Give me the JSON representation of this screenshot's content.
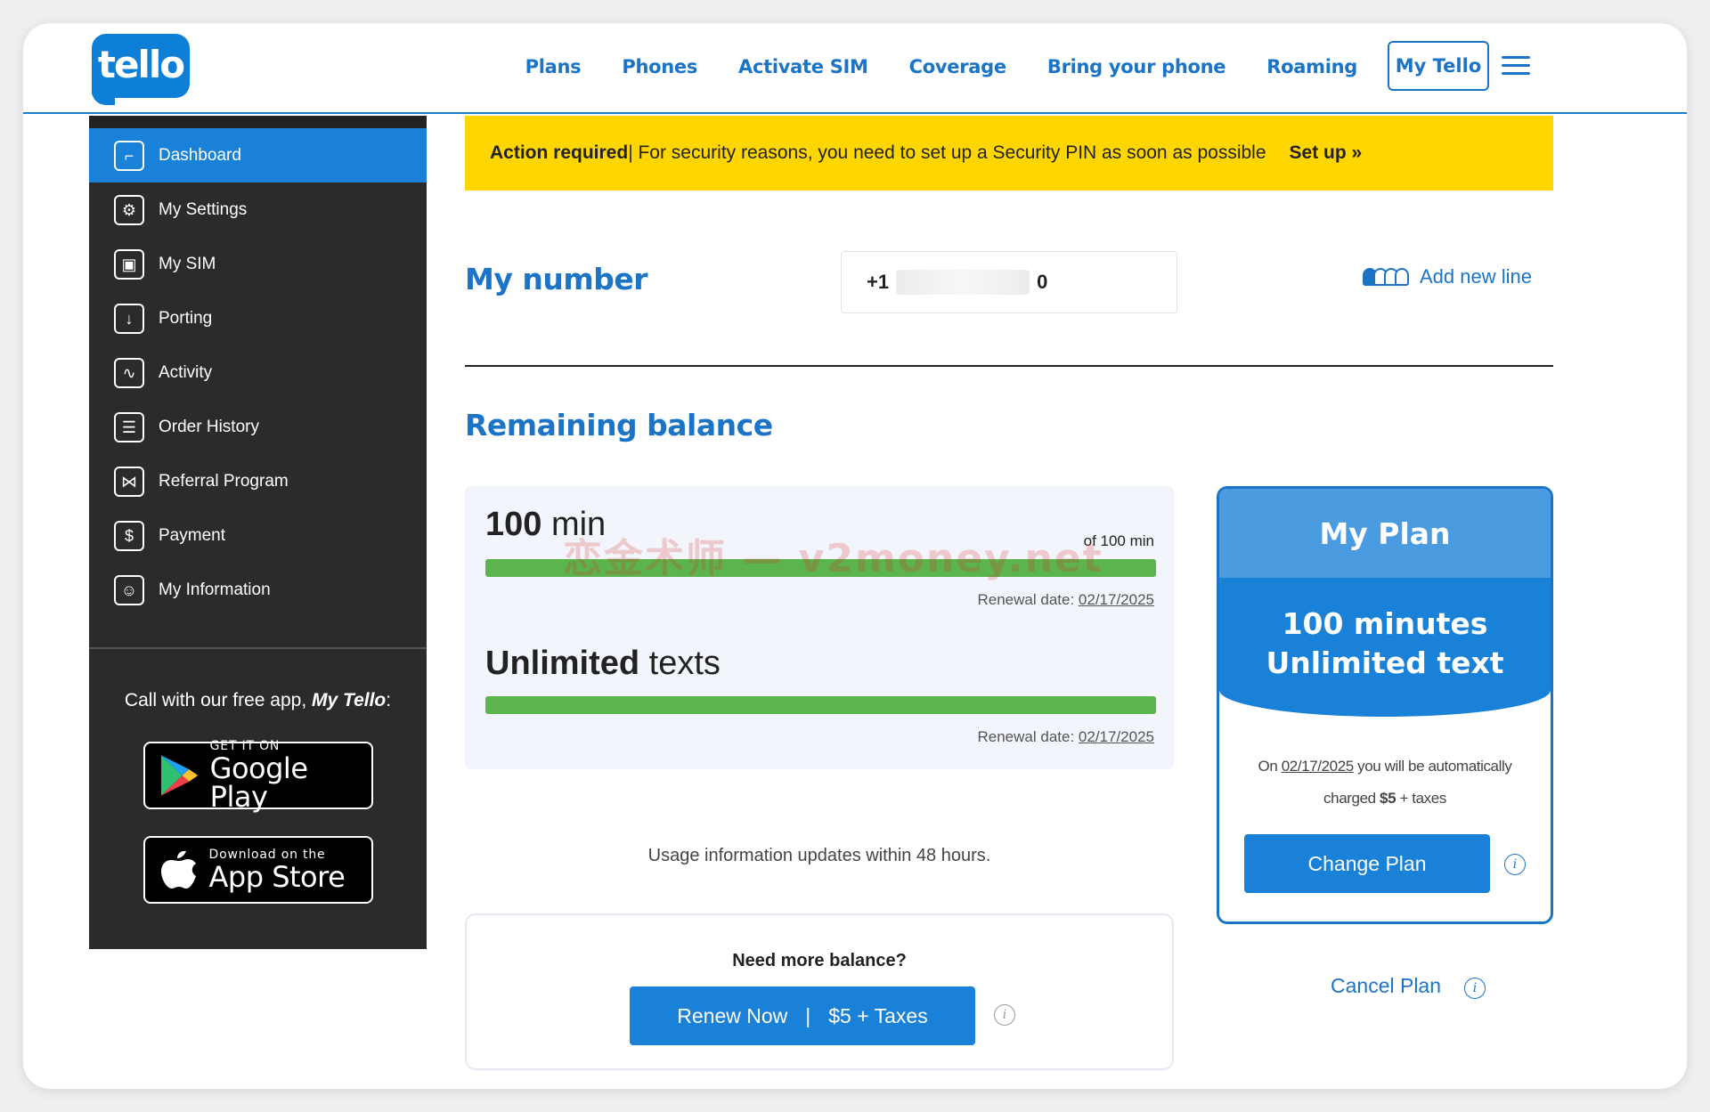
{
  "header": {
    "logo_text": "tello",
    "nav": [
      "Plans",
      "Phones",
      "Activate SIM",
      "Coverage",
      "Bring your phone",
      "Roaming"
    ],
    "my_tello": "My Tello"
  },
  "sidebar": {
    "items": [
      {
        "label": "Dashboard",
        "icon": "dashboard-icon",
        "glyph": "⌐"
      },
      {
        "label": "My Settings",
        "icon": "settings-icon",
        "glyph": "⚙"
      },
      {
        "label": "My SIM",
        "icon": "sim-icon",
        "glyph": "▣"
      },
      {
        "label": "Porting",
        "icon": "porting-icon",
        "glyph": "↓"
      },
      {
        "label": "Activity",
        "icon": "activity-icon",
        "glyph": "∿"
      },
      {
        "label": "Order History",
        "icon": "order-history-icon",
        "glyph": "☰"
      },
      {
        "label": "Referral Program",
        "icon": "referral-icon",
        "glyph": "⋈"
      },
      {
        "label": "Payment",
        "icon": "payment-icon",
        "glyph": "$"
      },
      {
        "label": "My Information",
        "icon": "user-icon",
        "glyph": "☺"
      }
    ],
    "promo_prefix": "Call with our free app, ",
    "promo_app": "My Tello",
    "promo_suffix": ":",
    "google_small": "GET IT ON",
    "google_big": "Google Play",
    "apple_small": "Download on the",
    "apple_big": "App Store"
  },
  "alert": {
    "strong": "Action required",
    "message": " | For security reasons, you need to set up a Security PIN as soon as possible",
    "action": "Set up »"
  },
  "number": {
    "title": "My number",
    "prefix": "+1",
    "suffix": "0",
    "add_line": "Add new line"
  },
  "balance": {
    "title": "Remaining balance",
    "minutes_value": "100",
    "minutes_unit": " min",
    "minutes_of": "of 100 min",
    "minutes_fraction": 1.0,
    "renewal_label": "Renewal date: ",
    "renewal_date": "02/17/2025",
    "texts_value": "Unlimited",
    "texts_unit": " texts",
    "texts_fraction": 1.0,
    "watermark": "恋金术师 — v2money.net",
    "note": "Usage information updates within 48 hours."
  },
  "need_more": {
    "question": "Need more balance?",
    "renew_label": "Renew Now",
    "separator": "|",
    "price": "$5 + Taxes"
  },
  "plan": {
    "title": "My Plan",
    "line1": "100 minutes",
    "line2": "Unlimited text",
    "charge_prefix": "On ",
    "charge_date": "02/17/2025",
    "charge_mid": " you will be automatically charged ",
    "charge_amount": "$5",
    "charge_suffix": " + taxes",
    "change_label": "Change Plan",
    "cancel_label": "Cancel Plan"
  },
  "colors": {
    "brand": "#1982d8",
    "alert": "#ffd600",
    "progress": "#5cb54c",
    "sidebar": "#2b2b2b"
  }
}
